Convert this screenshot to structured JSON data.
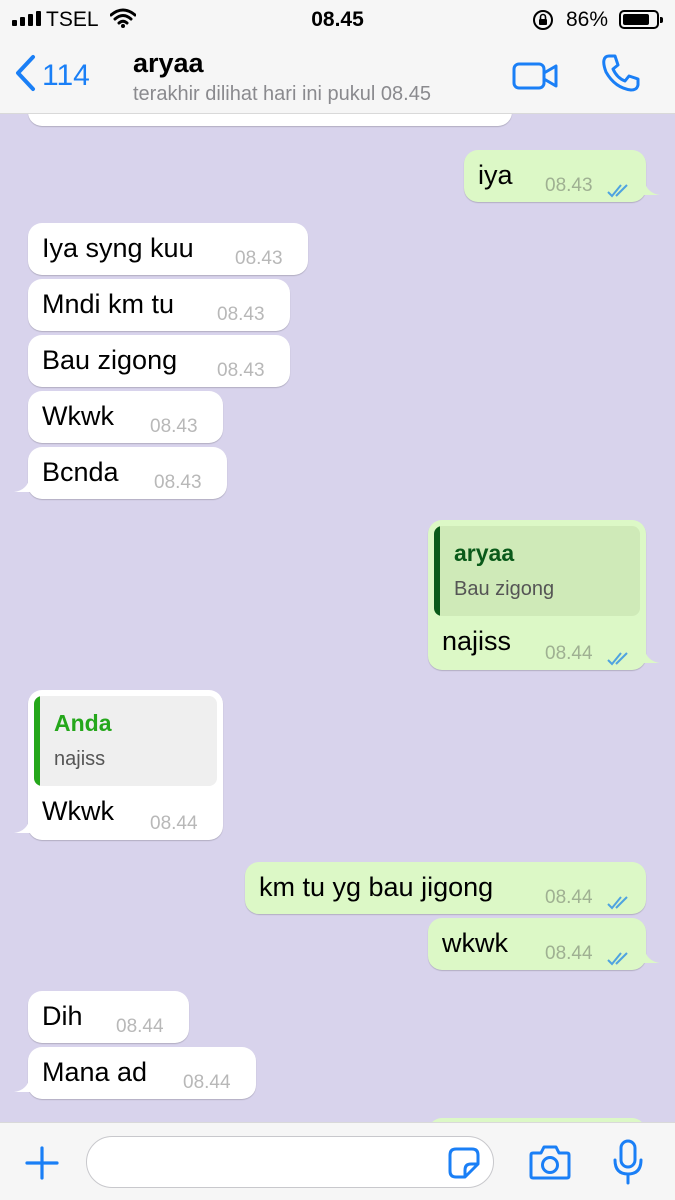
{
  "status_bar": {
    "carrier": "TSEL",
    "time": "08.45",
    "battery": "86%"
  },
  "header": {
    "back_count": "114",
    "contact_name": "aryaa",
    "contact_status": "terakhir dilihat hari ini pukul 08.45"
  },
  "messages": [
    {
      "dir": "out",
      "text": "iya",
      "time": "08.43"
    },
    {
      "dir": "in",
      "text": "Iya syng kuu",
      "time": "08.43"
    },
    {
      "dir": "in",
      "text": "Mndi km tu",
      "time": "08.43"
    },
    {
      "dir": "in",
      "text": "Bau zigong",
      "time": "08.43"
    },
    {
      "dir": "in",
      "text": "Wkwk",
      "time": "08.43"
    },
    {
      "dir": "in",
      "text": "Bcnda",
      "time": "08.43"
    },
    {
      "dir": "out",
      "quote_name": "aryaa",
      "quote_text": "Bau zigong",
      "text": "najiss",
      "time": "08.44"
    },
    {
      "dir": "in",
      "quote_name": "Anda",
      "quote_text": "najiss",
      "text": "Wkwk",
      "time": "08.44"
    },
    {
      "dir": "out",
      "text": "km tu yg bau jigong",
      "time": "08.44"
    },
    {
      "dir": "out",
      "text": "wkwk",
      "time": "08.44"
    },
    {
      "dir": "in",
      "text": "Dih",
      "time": "08.44"
    },
    {
      "dir": "in",
      "text": "Mana ad",
      "time": "08.44"
    }
  ],
  "input": {
    "placeholder": ""
  },
  "colors": {
    "accent": "#1a7ff6",
    "chat_bg": "#d8d3ec",
    "outgoing": "#dcf8c6",
    "incoming": "#ffffff",
    "read_ticks": "#4fa3e0"
  }
}
